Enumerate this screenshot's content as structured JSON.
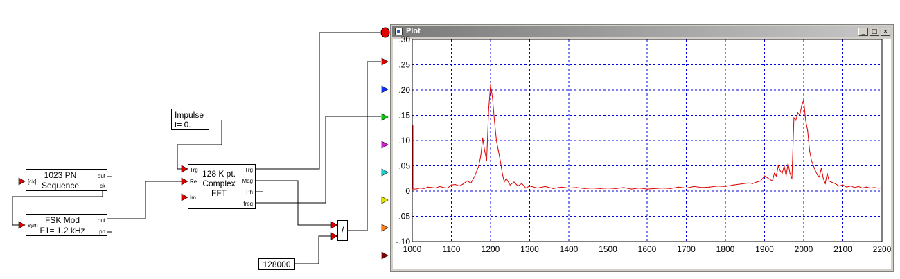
{
  "blocks": {
    "pn": {
      "line1": "1023 PN",
      "line2": "Sequence",
      "ports": {
        "in_ck": "[ck]",
        "out": "out",
        "ck": "ck"
      }
    },
    "fsk": {
      "line1": "FSK Mod",
      "line2": "F1= 1.2 kHz",
      "ports": {
        "in_sym": "sym",
        "out": "out",
        "ph": "ph"
      }
    },
    "impulse": {
      "line1": "Impulse",
      "line2": "t= 0."
    },
    "fft": {
      "line1": "128 K pt.",
      "line2": "Complex",
      "line3": "FFT",
      "ports": {
        "trg_in": "Trg",
        "re": "Re",
        "im": "Im",
        "trg_out": "Trg",
        "mag": "Mag",
        "ph": "Ph",
        "freq": "freq"
      }
    },
    "divide": {
      "symbol": "/"
    },
    "constant": {
      "value": "128000"
    }
  },
  "plot_window": {
    "title": "Plot",
    "buttons": {
      "minimize": "_",
      "maximize": "□",
      "close": "×"
    }
  },
  "input_arrows": {
    "colors": [
      "#e00000",
      "#1030ff",
      "#10c010",
      "#d020d0",
      "#20d0d0",
      "#e0e000",
      "#ff8020",
      "#800000"
    ]
  },
  "chart_data": {
    "type": "line",
    "title": "",
    "xlabel": "",
    "ylabel": "",
    "xlim": [
      1000,
      2200
    ],
    "ylim": [
      -0.1,
      0.3
    ],
    "x_ticks": [
      "1000",
      "1100",
      "1200",
      "1300",
      "1400",
      "1500",
      "1600",
      "1700",
      "1800",
      "1900",
      "2000",
      "2100",
      "2200"
    ],
    "y_ticks": [
      ".30",
      ".25",
      ".20",
      ".15",
      ".10",
      ".05",
      "0",
      "-.05",
      "-.10"
    ],
    "grid": true,
    "series": [
      {
        "color": "#dd0000",
        "x": [
          1000,
          1010,
          1020,
          1030,
          1040,
          1050,
          1060,
          1070,
          1080,
          1090,
          1100,
          1110,
          1120,
          1130,
          1140,
          1150,
          1160,
          1165,
          1170,
          1175,
          1180,
          1185,
          1190,
          1195,
          1200,
          1205,
          1210,
          1215,
          1220,
          1225,
          1230,
          1235,
          1240,
          1250,
          1260,
          1270,
          1280,
          1290,
          1300,
          1320,
          1340,
          1360,
          1380,
          1400,
          1420,
          1440,
          1460,
          1480,
          1500,
          1520,
          1540,
          1560,
          1580,
          1600,
          1620,
          1640,
          1660,
          1680,
          1700,
          1720,
          1740,
          1760,
          1780,
          1800,
          1820,
          1840,
          1860,
          1870,
          1880,
          1890,
          1900,
          1910,
          1920,
          1925,
          1930,
          1935,
          1940,
          1945,
          1950,
          1955,
          1960,
          1965,
          1970,
          1975,
          1980,
          1985,
          1990,
          1995,
          2000,
          2005,
          2010,
          2015,
          2020,
          2025,
          2030,
          2035,
          2040,
          2045,
          2050,
          2055,
          2060,
          2065,
          2070,
          2080,
          2090,
          2100,
          2110,
          2120,
          2130,
          2140,
          2150,
          2160,
          2170,
          2180,
          2190,
          2200
        ],
        "y": [
          0.004,
          0.004,
          0.006,
          0.005,
          0.008,
          0.007,
          0.006,
          0.009,
          0.007,
          0.006,
          0.012,
          0.013,
          0.01,
          0.014,
          0.02,
          0.016,
          0.03,
          0.04,
          0.05,
          0.07,
          0.105,
          0.08,
          0.06,
          0.16,
          0.21,
          0.185,
          0.14,
          0.1,
          0.08,
          0.06,
          0.035,
          0.018,
          0.025,
          0.012,
          0.018,
          0.01,
          0.015,
          0.006,
          0.01,
          0.006,
          0.009,
          0.005,
          0.008,
          0.006,
          0.007,
          0.005,
          0.006,
          0.005,
          0.006,
          0.005,
          0.007,
          0.004,
          0.006,
          0.004,
          0.005,
          0.006,
          0.005,
          0.008,
          0.006,
          0.009,
          0.007,
          0.008,
          0.01,
          0.009,
          0.012,
          0.014,
          0.016,
          0.015,
          0.018,
          0.02,
          0.03,
          0.025,
          0.02,
          0.035,
          0.03,
          0.05,
          0.04,
          0.035,
          0.05,
          0.03,
          0.055,
          0.035,
          0.025,
          0.145,
          0.14,
          0.155,
          0.15,
          0.17,
          0.18,
          0.14,
          0.12,
          0.08,
          0.06,
          0.05,
          0.04,
          0.032,
          0.028,
          0.045,
          0.025,
          0.015,
          0.035,
          0.02,
          0.018,
          0.015,
          0.01,
          0.012,
          0.008,
          0.01,
          0.007,
          0.009,
          0.006,
          0.008,
          0.006,
          0.007,
          0.006,
          0.006
        ]
      }
    ]
  }
}
